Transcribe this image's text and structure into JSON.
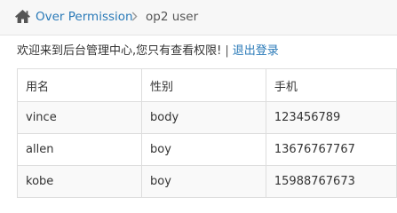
{
  "breadcrumb": {
    "root": "Over Permission",
    "current": "op2 user"
  },
  "welcome": {
    "message": "欢迎来到后台管理中心,您只有查看权限!",
    "divider": "|",
    "logout_link": "退出登录"
  },
  "table": {
    "headers": [
      "用名",
      "性别",
      "手机"
    ],
    "rows": [
      [
        "vince",
        "body",
        "123456789"
      ],
      [
        "allen",
        "boy",
        "13676767767"
      ],
      [
        "kobe",
        "boy",
        "15988767673"
      ]
    ]
  },
  "colors": {
    "link": "#2a7ab8",
    "text": "#333333",
    "breadcrumb_bg": "#f7f7f7",
    "border": "#dddddd"
  }
}
